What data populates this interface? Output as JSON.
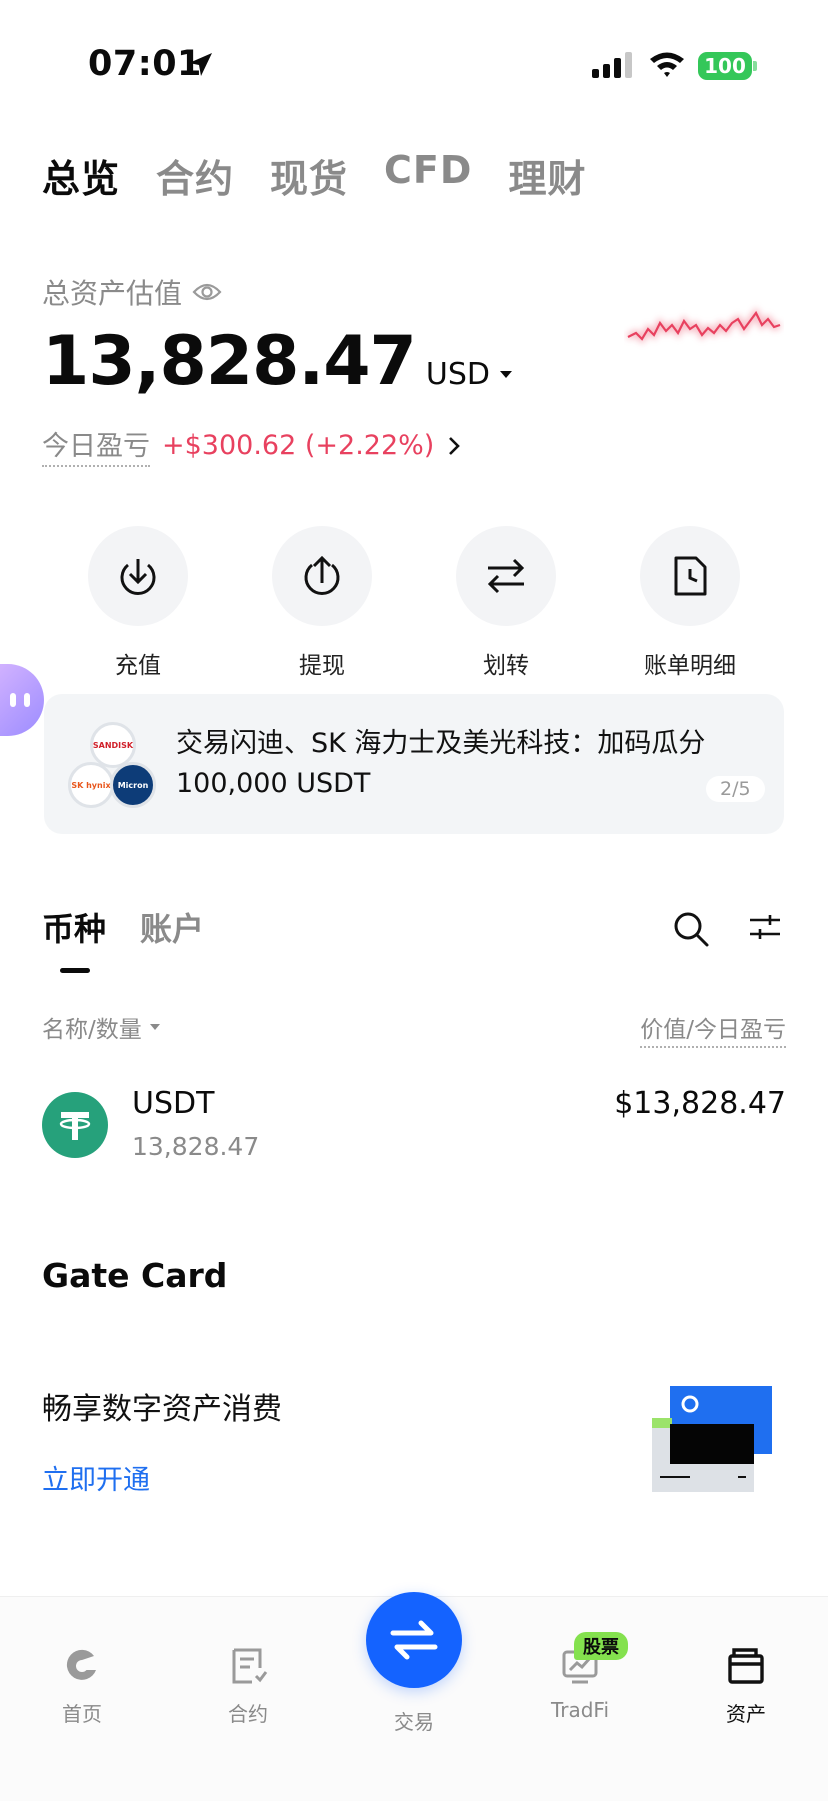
{
  "status_bar": {
    "time": "07:01",
    "battery": "100"
  },
  "top_tabs": [
    {
      "label": "总览",
      "active": true
    },
    {
      "label": "合约",
      "active": false
    },
    {
      "label": "现货",
      "active": false
    },
    {
      "label": "CFD",
      "active": false
    },
    {
      "label": "理财",
      "active": false
    }
  ],
  "overview": {
    "total_label": "总资产估值",
    "total_value": "13,828.47",
    "currency": "USD",
    "pnl_label": "今日盈亏",
    "pnl_value": "+$300.62 (+2.22%)",
    "accent_negative": "#e8415f"
  },
  "actions": [
    {
      "label": "充值",
      "icon": "deposit-icon"
    },
    {
      "label": "提现",
      "icon": "withdraw-icon"
    },
    {
      "label": "划转",
      "icon": "transfer-icon"
    },
    {
      "label": "账单明细",
      "icon": "bill-icon"
    }
  ],
  "banner": {
    "text": "交易闪迪、SK 海力士及美光科技：加码瓜分 100,000 USDT",
    "page": "2/5",
    "logos": [
      "SANDISK",
      "SK hynix",
      "Micron"
    ]
  },
  "asset_tabs": [
    {
      "label": "币种",
      "active": true
    },
    {
      "label": "账户",
      "active": false
    }
  ],
  "columns": {
    "left": "名称/数量",
    "right": "价值/今日盈亏"
  },
  "assets": [
    {
      "symbol": "USDT",
      "quantity": "13,828.47",
      "value": "$13,828.47"
    }
  ],
  "gate_card": {
    "title": "Gate Card",
    "subtitle": "畅享数字资产消费",
    "link": "立即开通"
  },
  "bottom_nav": [
    {
      "label": "首页",
      "icon": "home-icon"
    },
    {
      "label": "合约",
      "icon": "contract-icon"
    },
    {
      "label": "交易",
      "icon": "trade-icon"
    },
    {
      "label": "TradFi",
      "icon": "tradfi-icon",
      "badge": "股票"
    },
    {
      "label": "资产",
      "icon": "wallet-icon",
      "active": true
    }
  ],
  "colors": {
    "brand_blue": "#1463ff",
    "link_blue": "#1f6ff0",
    "usdt_green": "#26a17b",
    "badge_green": "#84e14e"
  }
}
